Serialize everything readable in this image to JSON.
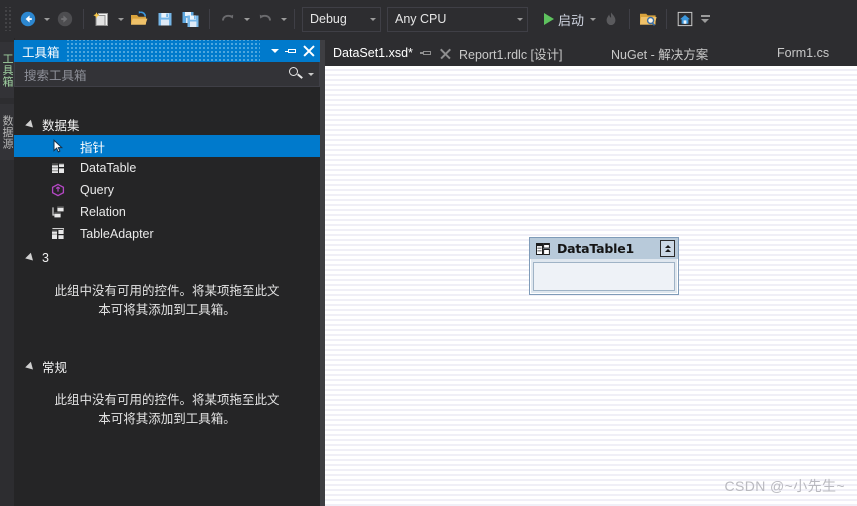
{
  "toolbar": {
    "nav_back": "back-arrow",
    "nav_forward": "forward-arrow",
    "new_item": "new-item",
    "open_file": "open-file",
    "save": "save",
    "save_all": "save-all",
    "undo": "undo",
    "redo": "redo",
    "config_value": "Debug",
    "platform_value": "Any CPU",
    "start_label": "启动",
    "hot_reload": "hot-reload",
    "search_folder": "search-in-folder",
    "home": "home",
    "overflow": "toolbar-overflow"
  },
  "vertical_tabs": [
    {
      "label": "工具箱",
      "selected": true
    },
    {
      "label": "数据源",
      "selected": false
    }
  ],
  "toolbox": {
    "title": "工具箱",
    "search_placeholder": "搜索工具箱",
    "buttons": {
      "dropdown": "chevron-down",
      "pin": "pin",
      "close": "close"
    },
    "groups": [
      {
        "name": "数据集",
        "expanded": true,
        "items": [
          {
            "label": "指针",
            "icon": "pointer-icon",
            "selected": true
          },
          {
            "label": "DataTable",
            "icon": "datatable-icon",
            "selected": false
          },
          {
            "label": "Query",
            "icon": "query-icon",
            "selected": false
          },
          {
            "label": "Relation",
            "icon": "relation-icon",
            "selected": false
          },
          {
            "label": "TableAdapter",
            "icon": "tableadapter-icon",
            "selected": false
          }
        ],
        "empty_text": ""
      },
      {
        "name": "3",
        "expanded": true,
        "items": [],
        "empty_text": "此组中没有可用的控件。将某项拖至此文本可将其添加到工具箱。"
      },
      {
        "name": "常规",
        "expanded": true,
        "items": [],
        "empty_text": "此组中没有可用的控件。将某项拖至此文本可将其添加到工具箱。"
      }
    ]
  },
  "document_tabs": [
    {
      "label": "DataSet1.xsd*",
      "active": true,
      "has_pin": true,
      "has_close": true
    },
    {
      "label": "Report1.rdlc [设计]",
      "active": false,
      "has_pin": false,
      "has_close": false
    },
    {
      "label": "NuGet - 解决方案",
      "active": false,
      "has_pin": false,
      "has_close": false
    },
    {
      "label": "Form1.cs",
      "active": false,
      "has_pin": false,
      "has_close": false
    }
  ],
  "designer": {
    "table": {
      "name": "DataTable1",
      "icon": "datatable-icon",
      "collapse_button": "collapse-chevrons"
    },
    "watermark": "CSDN @~小先生~"
  },
  "colors": {
    "accent": "#007acc",
    "toolbar_bg": "#2d2d30",
    "panel_bg": "#252526",
    "splitter": "#3e3e42",
    "surface": "#ffffff",
    "surface_stripe": "#f0eff7",
    "table_border": "#7f9bb8",
    "table_header": "#b8cada",
    "start_green": "#5ec25e"
  }
}
